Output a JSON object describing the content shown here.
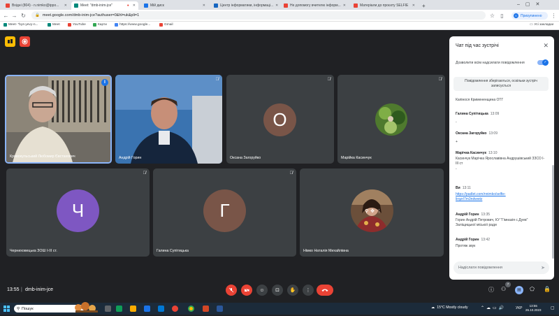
{
  "browser": {
    "tabs": [
      {
        "label": "Вхідні (804) - n.nimko@ippo...",
        "color": "#ea4335"
      },
      {
        "label": "Meet: \"dmb-inim-jce\"",
        "color": "#00897b"
      },
      {
        "label": "Мій диск",
        "color": "#1a73e8"
      },
      {
        "label": "Центр інформатики, інформаці...",
        "color": "#1565c0"
      },
      {
        "label": "Не допомогу вчителю інформ...",
        "color": "#ea4335"
      },
      {
        "label": "Матеріали до проєкту SELFIE",
        "color": "#ea4335"
      }
    ],
    "url": "meet.google.com/dmb-inim-jce?authuser=0&hl=uk&pli=1",
    "profile_label": "Призупинено",
    "profile_initial": "n",
    "bookmarks": [
      {
        "label": "Meet- \"bys-yevy-n...",
        "color": "#00897b"
      },
      {
        "label": "Meet",
        "color": "#00897b"
      },
      {
        "label": "YouTube",
        "color": "#ea4335"
      },
      {
        "label": "Карти",
        "color": "#34a853"
      },
      {
        "label": "https://www.google...",
        "color": "#4285f4"
      },
      {
        "label": "Gmail",
        "color": "#ea4335"
      }
    ],
    "bookmarks_all": "Усі закладки"
  },
  "tiles": [
    {
      "name": "Кривокульський Любомир Євстахович",
      "kind": "video1"
    },
    {
      "name": "Андрій Горин",
      "kind": "video2"
    },
    {
      "name": "Оксана Загоруйко",
      "kind": "letter",
      "letter": "О",
      "color": "#795548"
    },
    {
      "name": "Марійка Касинчук",
      "kind": "photo"
    },
    {
      "name": "Черниховецька ЗОШ І-ІІІ ст.",
      "kind": "letter",
      "letter": "Ч",
      "color": "#7e57c2"
    },
    {
      "name": "Галина Супітицька",
      "kind": "letter",
      "letter": "Г",
      "color": "#795548"
    },
    {
      "name": "Німко Наталія Михайлівна",
      "kind": "photo2"
    }
  ],
  "chat": {
    "title": "Чат під час зустрічі",
    "toggle_label": "Дозволити всім надсилати повідомлення",
    "notice": "Повідомлення зберігаються, оскільки зустріч записується",
    "messages": [
      {
        "sender": "",
        "time": "",
        "text": "Капінося Кримененщина ОТГ",
        "link": ""
      },
      {
        "sender": "Галина Супітицька",
        "time": "13:09",
        "text": "-",
        "link": ""
      },
      {
        "sender": "Оксана Загоруйко",
        "time": "13:09",
        "text": "+",
        "link": ""
      },
      {
        "sender": "Марічка Касинчук",
        "time": "13:10",
        "text": "Касинчук Марічка Ярославівна Андрушівський ЗЗСО І-ІІІ ст",
        "link": ""
      },
      {
        "sender": "Ви",
        "time": "13:11",
        "text": "",
        "link": "https://padlet.com/nnimko/selfie-lirqzrl7m3ndwwtz"
      },
      {
        "sender": "Андрій Горин",
        "time": "13:35",
        "text": "Горин Андрій Петрович, КУ \"Гімназія с.Дуев\" Заліщицької міської ради",
        "link": ""
      },
      {
        "sender": "Андрій Горин",
        "time": "13:42",
        "text": "Протяж звук",
        "link": ""
      }
    ],
    "input_placeholder": "Надіслати повідомлення"
  },
  "bottom": {
    "time": "13:55",
    "meeting_code": "dmb-inim-jce",
    "participants_count": "7"
  },
  "taskbar": {
    "search_label": "Пошук",
    "weather": "15°C  Mostly cloudy",
    "lang": "УКР",
    "clock_time": "13:55",
    "clock_date": "26.10.2023"
  }
}
